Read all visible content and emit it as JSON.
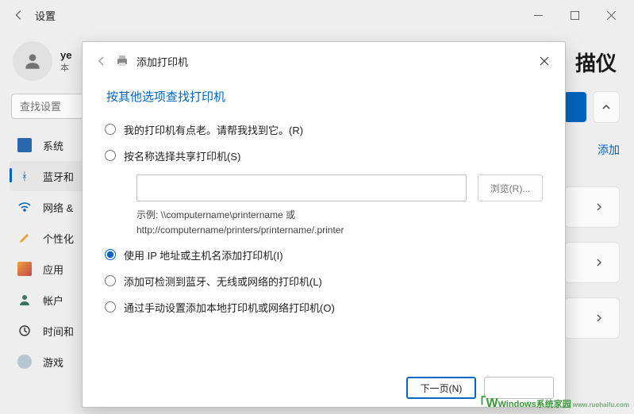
{
  "titlebar": {
    "title": "设置"
  },
  "user": {
    "name": "ye",
    "account": "本"
  },
  "search": {
    "placeholder": "查找设置"
  },
  "sidebar": {
    "items": [
      {
        "label": "系统"
      },
      {
        "label": "蓝牙和"
      },
      {
        "label": "网络 &"
      },
      {
        "label": "个性化"
      },
      {
        "label": "应用"
      },
      {
        "label": "帐户"
      },
      {
        "label": "时间和"
      },
      {
        "label": "游戏"
      }
    ]
  },
  "main": {
    "page_title_fragment": "描仪",
    "add_label": "添加"
  },
  "modal": {
    "title": "添加打印机",
    "subtitle": "按其他选项查找打印机",
    "options": {
      "old": "我的打印机有点老。请帮我找到它。(R)",
      "share": "按名称选择共享打印机(S)",
      "ip": "使用 IP 地址或主机名添加打印机(I)",
      "wireless": "添加可检测到蓝牙、无线或网络的打印机(L)",
      "manual": "通过手动设置添加本地打印机或网络打印机(O)"
    },
    "browse": "浏览(R)...",
    "example": "示例: \\\\computername\\printername 或\nhttp://computername/printers/printername/.printer",
    "next": "下一页(N)",
    "cancel": ""
  },
  "watermark": {
    "brand": "Windows",
    "text": "系统家园",
    "url": "www.ruohaifu.com"
  }
}
